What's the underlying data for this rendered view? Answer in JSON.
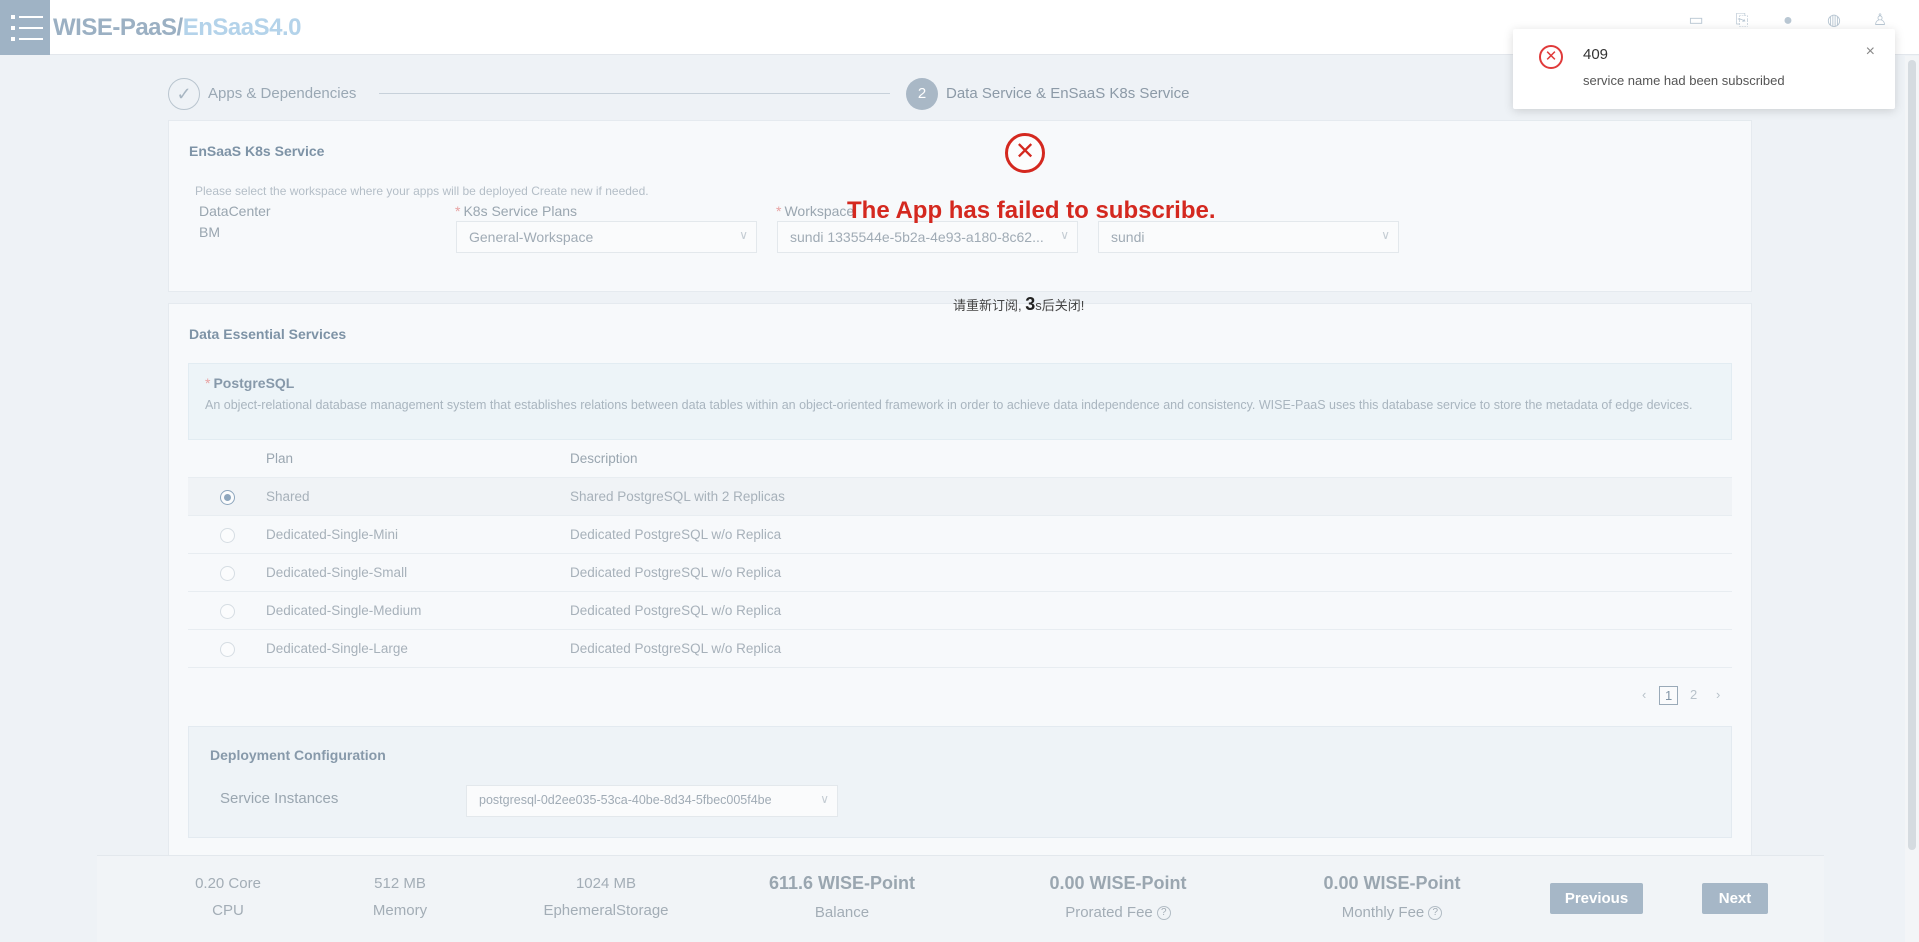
{
  "header": {
    "logo_part1": "WISE-PaaS/",
    "logo_part2": "EnSaaS4.0",
    "icons": [
      "window-icon",
      "bookmark-icon",
      "location-icon",
      "globe-icon",
      "user-icon"
    ]
  },
  "steps": [
    {
      "index": "✓",
      "label": "Apps & Dependencies",
      "state": "done"
    },
    {
      "index": "2",
      "label": "Data Service & EnSaaS K8s Service",
      "state": "active"
    }
  ],
  "k8s": {
    "title": "EnSaaS K8s Service",
    "hint": "Please select the workspace where your apps will be deployed Create new if needed.",
    "datacenter_label": "DataCenter",
    "datacenter_value": "BM",
    "plans_label": "K8s Service Plans",
    "plans_value": "General-Workspace",
    "workspace_label": "Workspace",
    "workspace_value": "sundi 1335544e-5b2a-4e93-a180-8c62...",
    "namespace_value": "sundi"
  },
  "data_services": {
    "title": "Data Essential Services",
    "postgres_title": "PostgreSQL",
    "postgres_desc": "An object-relational database management system that establishes relations between data tables within an object-oriented framework in order to achieve data independence and consistency. WISE-PaaS uses this database service to store the metadata of edge devices.",
    "columns": {
      "plan": "Plan",
      "description": "Description"
    },
    "rows": [
      {
        "plan": "Shared",
        "description": "Shared PostgreSQL with 2 Replicas",
        "selected": true
      },
      {
        "plan": "Dedicated-Single-Mini",
        "description": "Dedicated PostgreSQL w/o Replica",
        "selected": false
      },
      {
        "plan": "Dedicated-Single-Small",
        "description": "Dedicated PostgreSQL w/o Replica",
        "selected": false
      },
      {
        "plan": "Dedicated-Single-Medium",
        "description": "Dedicated PostgreSQL w/o Replica",
        "selected": false
      },
      {
        "plan": "Dedicated-Single-Large",
        "description": "Dedicated PostgreSQL w/o Replica",
        "selected": false
      }
    ],
    "pagination": {
      "prev": "‹",
      "pages": [
        "1",
        "2"
      ],
      "current": "1",
      "next": "›"
    }
  },
  "deploy": {
    "title": "Deployment Configuration",
    "instances_label": "Service Instances",
    "instances_value": "postgresql-0d2ee035-53ca-40be-8d34-5fbec005f4be"
  },
  "footer": {
    "cpu_value": "0.20 Core",
    "cpu_label": "CPU",
    "memory_value": "512 MB",
    "memory_label": "Memory",
    "storage_value": "1024 MB",
    "storage_label": "EphemeralStorage",
    "balance_value": "611.6 WISE-Point",
    "balance_label": "Balance",
    "prorated_value": "0.00 WISE-Point",
    "prorated_label": "Prorated Fee",
    "monthly_value": "0.00 WISE-Point",
    "monthly_label": "Monthly Fee",
    "previous": "Previous",
    "next": "Next"
  },
  "overlay": {
    "message": "The App has failed to subscribe.",
    "countdown_prefix": "请重新订阅, ",
    "countdown_number": "3",
    "countdown_suffix": "s后关闭!"
  },
  "toast": {
    "title": "409",
    "message": "service name had been subscribed",
    "close": "×"
  },
  "colors": {
    "error": "#d4281f",
    "accent": "#9fb3c5"
  }
}
